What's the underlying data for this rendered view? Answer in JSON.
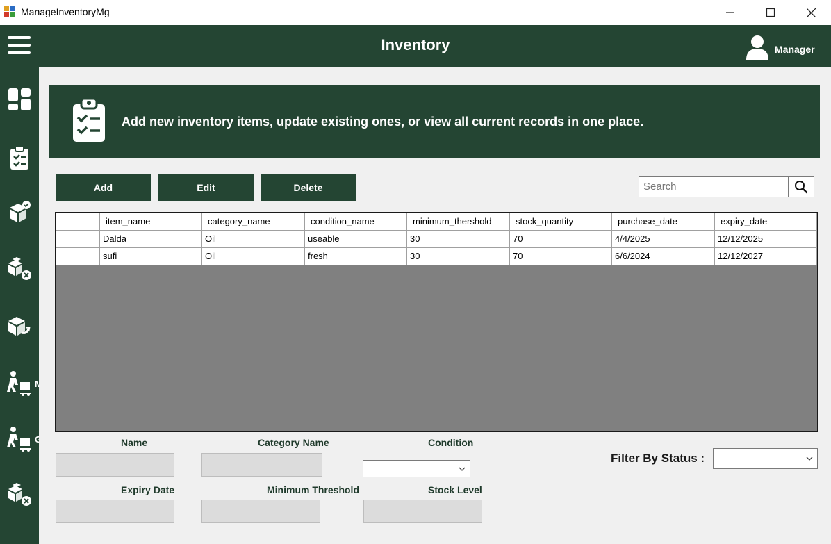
{
  "window": {
    "title": "ManageInventoryMg",
    "minimize_icon": "minimize-icon",
    "maximize_icon": "maximize-icon",
    "close_icon": "close-icon"
  },
  "header": {
    "title": "Inventory",
    "user_label": "Manager",
    "menu_icon": "hamburger-menu-icon",
    "user_icon": "user-icon"
  },
  "sidebar": {
    "items": [
      {
        "icon": "dashboard-icon",
        "label": ""
      },
      {
        "icon": "clipboard-checklist-icon",
        "label": ""
      },
      {
        "icon": "box-check-icon",
        "label": ""
      },
      {
        "icon": "boxes-remove-icon",
        "label": ""
      },
      {
        "icon": "box-return-icon",
        "label": ""
      },
      {
        "icon": "delivery-person-icon",
        "label": "M"
      },
      {
        "icon": "delivery-person-icon",
        "label": "G"
      },
      {
        "icon": "boxes-remove-icon",
        "label": ""
      }
    ]
  },
  "banner": {
    "icon": "clipboard-checklist-icon",
    "text": "Add new inventory items, update existing ones, or view all current records in one place."
  },
  "toolbar": {
    "add_label": "Add",
    "edit_label": "Edit",
    "delete_label": "Delete"
  },
  "search": {
    "placeholder": "Search",
    "icon": "search-icon"
  },
  "table": {
    "columns": [
      "item_name",
      "category_name",
      "condition_name",
      "minimum_thershold",
      "stock_quantity",
      "purchase_date",
      "expiry_date"
    ],
    "rows": [
      [
        "Dalda",
        "Oil",
        "useable",
        "30",
        "70",
        "4/4/2025",
        "12/12/2025"
      ],
      [
        "sufi",
        "Oil",
        "fresh",
        "30",
        "70",
        "6/6/2024",
        "12/12/2027"
      ]
    ]
  },
  "form": {
    "name_label": "Name",
    "category_label": "Category Name",
    "condition_label": "Condition",
    "expiry_label": "Expiry Date",
    "threshold_label": "Minimum Threshold",
    "stock_label": "Stock Level",
    "name_value": "",
    "category_value": "",
    "condition_value": "",
    "expiry_value": "",
    "threshold_value": "",
    "stock_value": ""
  },
  "filter": {
    "label": "Filter By Status :",
    "value": ""
  },
  "colors": {
    "primary": "#244533",
    "background": "#f0f0f0",
    "grid_empty": "#808080"
  }
}
